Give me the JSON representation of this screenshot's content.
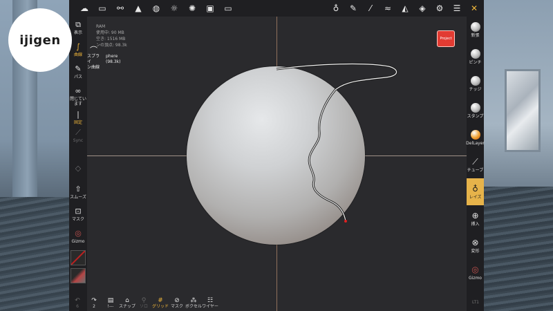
{
  "logo": {
    "text": "ijigen"
  },
  "top_toolbar": {
    "left_icons": [
      "nomad-logo-icon",
      "folder-icon",
      "scene-graph-icon",
      "topology-icon",
      "globe-icon",
      "light-icon",
      "render-icon",
      "image-icon",
      "video-icon"
    ],
    "right_icons": [
      "material-icon",
      "paint-icon",
      "picker-icon",
      "brush-settings-icon",
      "stroke-icon",
      "layers-icon",
      "settings-icon",
      "menu-icon",
      "tools-icon"
    ]
  },
  "stats": {
    "line1": "RAM",
    "line2": "使用中: 90 MB",
    "line3": "空き: 1516 MB",
    "line4": "ンの頂点: 98.3k"
  },
  "tool_popup": {
    "label1": "スプライ",
    "label2": "ン曲線",
    "object": "phere (98.3k)"
  },
  "project_button": {
    "label": "Project"
  },
  "left_toolbar": {
    "items": [
      {
        "icon": "⧉",
        "label": "表示"
      },
      {
        "icon": "∫",
        "label": "曲線"
      },
      {
        "icon": "✎",
        "label": "パス"
      },
      {
        "icon": "∞",
        "label": "閉じています"
      },
      {
        "icon": "|",
        "label": "固定"
      },
      {
        "icon": "⟋",
        "label": "Sync"
      },
      {
        "icon": "◇",
        "label": ""
      },
      {
        "icon": "⇧",
        "label": "スムーズ"
      },
      {
        "icon": "⊡",
        "label": "マスク"
      },
      {
        "icon": "◎",
        "label": "Gizmo"
      }
    ]
  },
  "right_toolbar": {
    "items": [
      {
        "label": "新張"
      },
      {
        "label": "ピンチ"
      },
      {
        "label": "ナッジ"
      },
      {
        "label": "スタンプ"
      },
      {
        "label": "DelLayer"
      },
      {
        "label": "チューブ"
      },
      {
        "label": "レイズ"
      },
      {
        "label": "挿入"
      },
      {
        "label": "変形"
      },
      {
        "label": "Gizmo"
      }
    ]
  },
  "bottom_toolbar": {
    "items": [
      {
        "icon": "↶",
        "label": "6"
      },
      {
        "icon": "↷",
        "label": "2"
      },
      {
        "icon": "▤",
        "label": "!---"
      },
      {
        "icon": "⌂",
        "label": "スナップ"
      },
      {
        "icon": "⚲",
        "label": "ソロ"
      },
      {
        "icon": "#",
        "label": "グリッド"
      },
      {
        "icon": "⊘",
        "label": "マスク"
      },
      {
        "icon": "⁂",
        "label": "ボクセル"
      },
      {
        "icon": "☷",
        "label": "ワイヤー"
      }
    ]
  },
  "corner_label": "LT1",
  "colors": {
    "accent": "#f0b63a",
    "project": "#e23b32",
    "panel": "#1f1f22"
  }
}
